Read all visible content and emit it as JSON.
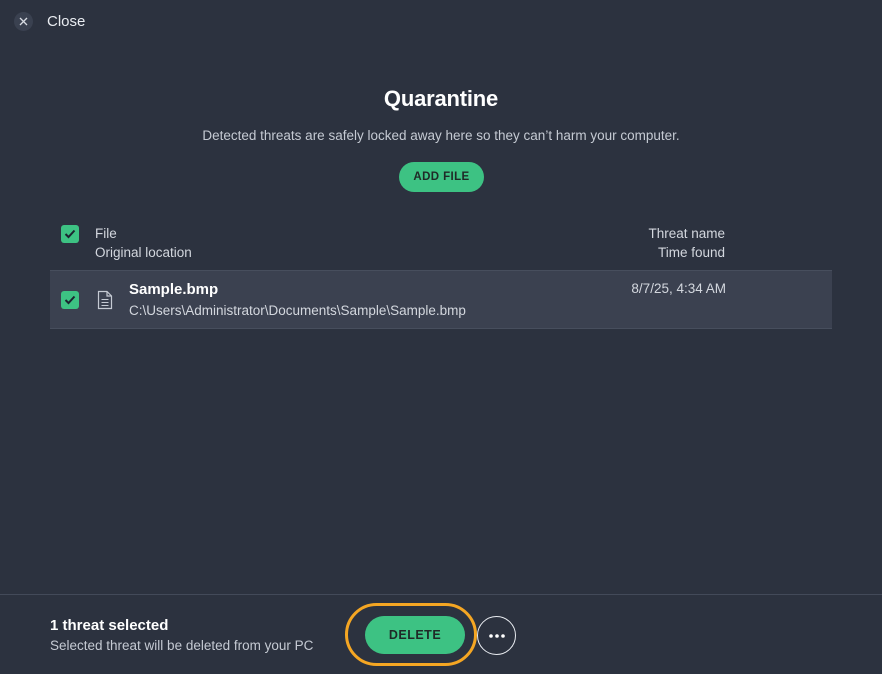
{
  "close": {
    "label": "Close",
    "icon": "close-icon"
  },
  "header": {
    "title": "Quarantine",
    "subtitle": "Detected threats are safely locked away here so they can’t harm your computer.",
    "add_file_label": "ADD FILE"
  },
  "table": {
    "columns": {
      "left_top": "File",
      "left_bottom": "Original location",
      "right_top": "Threat name",
      "right_bottom": "Time found"
    },
    "select_all_checked": true,
    "rows": [
      {
        "checked": true,
        "icon": "document-icon",
        "file": "Sample.bmp",
        "location": "C:\\Users\\Administrator\\Documents\\Sample\\Sample.bmp",
        "time": "8/7/25, 4:34 AM"
      }
    ]
  },
  "footer": {
    "selected_count": "1 threat selected",
    "selected_desc": "Selected threat will be deleted from your PC",
    "delete_label": "DELETE",
    "more_icon": "more-options-icon"
  },
  "colors": {
    "background": "#2c323f",
    "accent": "#3dc283",
    "highlight": "#f5a623",
    "row": "#3b4150"
  }
}
